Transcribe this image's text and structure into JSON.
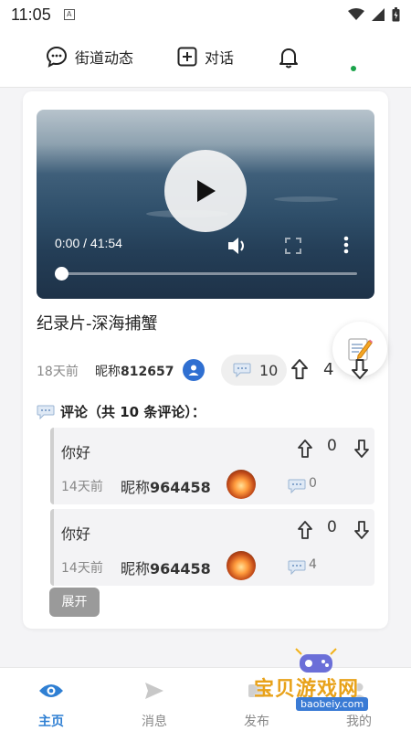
{
  "status_bar": {
    "time": "11:05",
    "notif_badge": "A"
  },
  "top_nav": {
    "street_label": "街道动态",
    "chat_label": "对话",
    "online_dot_color": "#1aa34a"
  },
  "post": {
    "video": {
      "time_display": "0:00 / 41:54"
    },
    "title": "纪录片-深海捕蟹",
    "time_ago": "18天前",
    "nick_prefix": "昵称",
    "nick_id": "812657",
    "comment_count": "10",
    "vote_count": "4"
  },
  "comments": {
    "header": "评论（共 10 条评论）：",
    "items": [
      {
        "text": "你好",
        "score": "0",
        "time_ago": "14天前",
        "nick_prefix": "昵称",
        "nick_id": "964458",
        "reply_count": "0"
      },
      {
        "text": "你好",
        "score": "0",
        "time_ago": "14天前",
        "nick_prefix": "昵称",
        "nick_id": "964458",
        "reply_count": "4"
      }
    ],
    "expand_label": "展开"
  },
  "bottom_nav": {
    "tabs": [
      {
        "label": "主页",
        "icon": "eye-icon",
        "active": true
      },
      {
        "label": "消息",
        "icon": "send-icon",
        "active": false
      },
      {
        "label": "发布",
        "icon": "publish-icon",
        "active": false
      },
      {
        "label": "我的",
        "icon": "profile-icon",
        "active": false
      }
    ],
    "active_color": "#2f7fd3"
  },
  "watermark": {
    "name": "宝贝游戏网",
    "url": "baobeiy.com"
  }
}
